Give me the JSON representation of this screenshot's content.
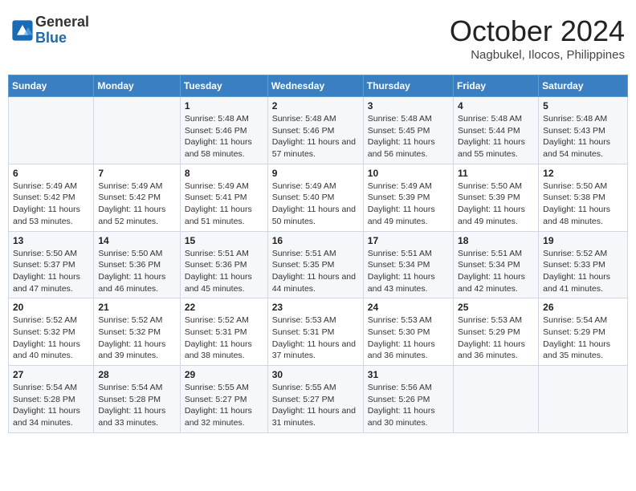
{
  "logo": {
    "general": "General",
    "blue": "Blue"
  },
  "title": "October 2024",
  "location": "Nagbukel, Ilocos, Philippines",
  "weekdays": [
    "Sunday",
    "Monday",
    "Tuesday",
    "Wednesday",
    "Thursday",
    "Friday",
    "Saturday"
  ],
  "weeks": [
    [
      {
        "day": "",
        "info": ""
      },
      {
        "day": "",
        "info": ""
      },
      {
        "day": "1",
        "info": "Sunrise: 5:48 AM\nSunset: 5:46 PM\nDaylight: 11 hours and 58 minutes."
      },
      {
        "day": "2",
        "info": "Sunrise: 5:48 AM\nSunset: 5:46 PM\nDaylight: 11 hours and 57 minutes."
      },
      {
        "day": "3",
        "info": "Sunrise: 5:48 AM\nSunset: 5:45 PM\nDaylight: 11 hours and 56 minutes."
      },
      {
        "day": "4",
        "info": "Sunrise: 5:48 AM\nSunset: 5:44 PM\nDaylight: 11 hours and 55 minutes."
      },
      {
        "day": "5",
        "info": "Sunrise: 5:48 AM\nSunset: 5:43 PM\nDaylight: 11 hours and 54 minutes."
      }
    ],
    [
      {
        "day": "6",
        "info": "Sunrise: 5:49 AM\nSunset: 5:42 PM\nDaylight: 11 hours and 53 minutes."
      },
      {
        "day": "7",
        "info": "Sunrise: 5:49 AM\nSunset: 5:42 PM\nDaylight: 11 hours and 52 minutes."
      },
      {
        "day": "8",
        "info": "Sunrise: 5:49 AM\nSunset: 5:41 PM\nDaylight: 11 hours and 51 minutes."
      },
      {
        "day": "9",
        "info": "Sunrise: 5:49 AM\nSunset: 5:40 PM\nDaylight: 11 hours and 50 minutes."
      },
      {
        "day": "10",
        "info": "Sunrise: 5:49 AM\nSunset: 5:39 PM\nDaylight: 11 hours and 49 minutes."
      },
      {
        "day": "11",
        "info": "Sunrise: 5:50 AM\nSunset: 5:39 PM\nDaylight: 11 hours and 49 minutes."
      },
      {
        "day": "12",
        "info": "Sunrise: 5:50 AM\nSunset: 5:38 PM\nDaylight: 11 hours and 48 minutes."
      }
    ],
    [
      {
        "day": "13",
        "info": "Sunrise: 5:50 AM\nSunset: 5:37 PM\nDaylight: 11 hours and 47 minutes."
      },
      {
        "day": "14",
        "info": "Sunrise: 5:50 AM\nSunset: 5:36 PM\nDaylight: 11 hours and 46 minutes."
      },
      {
        "day": "15",
        "info": "Sunrise: 5:51 AM\nSunset: 5:36 PM\nDaylight: 11 hours and 45 minutes."
      },
      {
        "day": "16",
        "info": "Sunrise: 5:51 AM\nSunset: 5:35 PM\nDaylight: 11 hours and 44 minutes."
      },
      {
        "day": "17",
        "info": "Sunrise: 5:51 AM\nSunset: 5:34 PM\nDaylight: 11 hours and 43 minutes."
      },
      {
        "day": "18",
        "info": "Sunrise: 5:51 AM\nSunset: 5:34 PM\nDaylight: 11 hours and 42 minutes."
      },
      {
        "day": "19",
        "info": "Sunrise: 5:52 AM\nSunset: 5:33 PM\nDaylight: 11 hours and 41 minutes."
      }
    ],
    [
      {
        "day": "20",
        "info": "Sunrise: 5:52 AM\nSunset: 5:32 PM\nDaylight: 11 hours and 40 minutes."
      },
      {
        "day": "21",
        "info": "Sunrise: 5:52 AM\nSunset: 5:32 PM\nDaylight: 11 hours and 39 minutes."
      },
      {
        "day": "22",
        "info": "Sunrise: 5:52 AM\nSunset: 5:31 PM\nDaylight: 11 hours and 38 minutes."
      },
      {
        "day": "23",
        "info": "Sunrise: 5:53 AM\nSunset: 5:31 PM\nDaylight: 11 hours and 37 minutes."
      },
      {
        "day": "24",
        "info": "Sunrise: 5:53 AM\nSunset: 5:30 PM\nDaylight: 11 hours and 36 minutes."
      },
      {
        "day": "25",
        "info": "Sunrise: 5:53 AM\nSunset: 5:29 PM\nDaylight: 11 hours and 36 minutes."
      },
      {
        "day": "26",
        "info": "Sunrise: 5:54 AM\nSunset: 5:29 PM\nDaylight: 11 hours and 35 minutes."
      }
    ],
    [
      {
        "day": "27",
        "info": "Sunrise: 5:54 AM\nSunset: 5:28 PM\nDaylight: 11 hours and 34 minutes."
      },
      {
        "day": "28",
        "info": "Sunrise: 5:54 AM\nSunset: 5:28 PM\nDaylight: 11 hours and 33 minutes."
      },
      {
        "day": "29",
        "info": "Sunrise: 5:55 AM\nSunset: 5:27 PM\nDaylight: 11 hours and 32 minutes."
      },
      {
        "day": "30",
        "info": "Sunrise: 5:55 AM\nSunset: 5:27 PM\nDaylight: 11 hours and 31 minutes."
      },
      {
        "day": "31",
        "info": "Sunrise: 5:56 AM\nSunset: 5:26 PM\nDaylight: 11 hours and 30 minutes."
      },
      {
        "day": "",
        "info": ""
      },
      {
        "day": "",
        "info": ""
      }
    ]
  ]
}
